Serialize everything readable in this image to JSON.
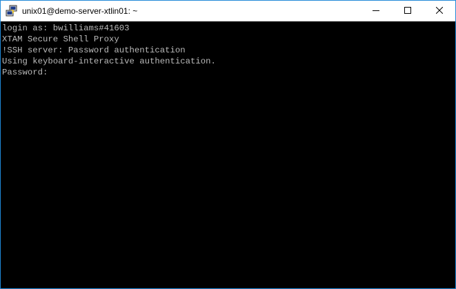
{
  "window": {
    "title": "unix01@demo-server-xtlin01: ~",
    "app_icon": "putty-icon",
    "controls": {
      "minimize_icon": "minimize-icon",
      "maximize_icon": "maximize-icon",
      "close_icon": "close-icon"
    }
  },
  "terminal": {
    "background": "#000000",
    "foreground": "#bbbbbb",
    "lines": [
      "login as: bwilliams#41603",
      "XTAM Secure Shell Proxy",
      "!SSH server: Password authentication",
      "Using keyboard-interactive authentication.",
      "Password:"
    ]
  }
}
